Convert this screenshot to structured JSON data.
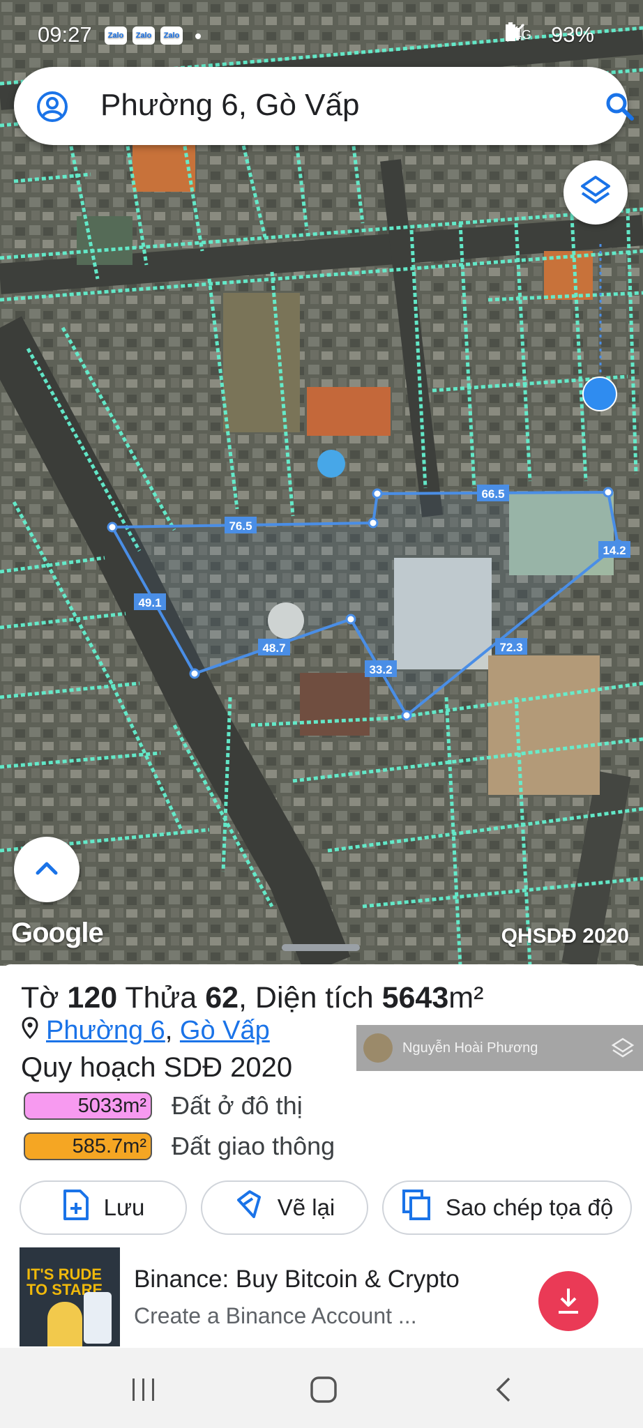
{
  "status_bar": {
    "time": "09:27",
    "notifications": [
      "Zalo",
      "Zalo",
      "Zalo"
    ],
    "network": "4G",
    "battery": "93%"
  },
  "search": {
    "title": "Phường 6, Gò Vấp"
  },
  "map": {
    "measurements": [
      "76.5",
      "66.5",
      "14.2",
      "49.1",
      "48.7",
      "33.2",
      "72.3"
    ],
    "attribution": "Google",
    "overlay_label": "QHSDĐ 2020",
    "colors": {
      "parcel_outline": "#64f0cf",
      "measure_line": "#4a8ee6",
      "label_bg": "#4a8ee6"
    }
  },
  "panel": {
    "to_label": "Tờ",
    "to_value": "120",
    "thua_label": "Thửa",
    "thua_value": "62",
    "area_label": ", Diện tích",
    "area_value": "5643",
    "area_unit": "m²",
    "ward": "Phường 6",
    "district": "Gò Vấp",
    "plan_title": "Quy hoạch SDĐ 2020",
    "legend": [
      {
        "value": "5033m²",
        "label": "Đất ở đô thị",
        "color": "#f79af0"
      },
      {
        "value": "585.7m²",
        "label": "Đất giao thông",
        "color": "#f5a623"
      }
    ],
    "actions": {
      "save": "Lưu",
      "redraw": "Vẽ lại",
      "copy_coords": "Sao chép tọa độ"
    }
  },
  "watermark": {
    "name": "Nguyễn Hoài Phương"
  },
  "ad": {
    "image_text": "IT'S RUDE TO STARE",
    "title": "Binance: Buy Bitcoin & Crypto",
    "subtitle": "Create a Binance Account ..."
  }
}
